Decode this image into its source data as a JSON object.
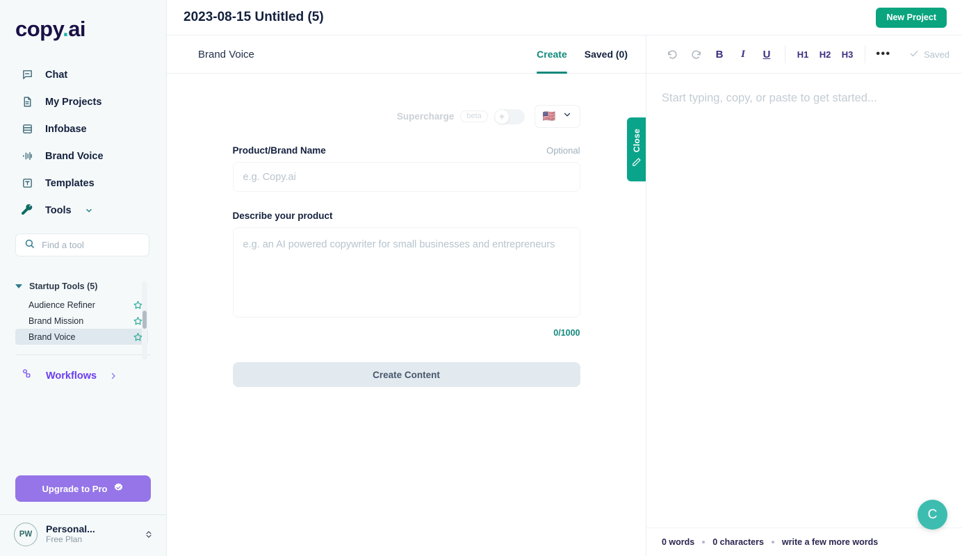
{
  "brand": {
    "logo_main": "copy",
    "logo_dot": ".",
    "logo_suffix": "ai"
  },
  "colors": {
    "accent_teal": "#12897c",
    "brand_green": "#0aa47f",
    "purple": "#6b3df0",
    "upgrade_purple": "#9575e8",
    "sidebar_bg": "#f5f9fa",
    "fab_teal": "#3dbdb0"
  },
  "sidebar": {
    "nav": [
      {
        "label": "Chat",
        "icon": "chat-bubble-icon"
      },
      {
        "label": "My Projects",
        "icon": "document-icon"
      },
      {
        "label": "Infobase",
        "icon": "database-icon"
      },
      {
        "label": "Brand Voice",
        "icon": "waveform-icon"
      },
      {
        "label": "Templates",
        "icon": "template-icon"
      },
      {
        "label": "Tools",
        "icon": "wrench-icon"
      }
    ],
    "search": {
      "placeholder": "Find a tool",
      "value": "",
      "icon": "search-icon"
    },
    "tool_group": {
      "label": "Startup Tools (5)",
      "items": [
        {
          "label": "Audience Refiner",
          "starred": false
        },
        {
          "label": "Brand Mission",
          "starred": false
        },
        {
          "label": "Brand Voice",
          "starred": false,
          "active": true
        }
      ]
    },
    "workflows": {
      "label": "Workflows",
      "icon": "workflow-icon"
    },
    "upgrade": {
      "label": "Upgrade to Pro",
      "icon": "badge-check-icon"
    },
    "user": {
      "initials": "PW",
      "name": "Personal...",
      "plan": "Free Plan"
    }
  },
  "topbar": {
    "doc_title": "2023-08-15 Untitled (5)",
    "new_project_label": "New Project"
  },
  "form_panel": {
    "tool_title": "Brand Voice",
    "tabs": [
      {
        "label": "Create",
        "active": true
      },
      {
        "label": "Saved (0)",
        "active": false
      }
    ],
    "supercharge": {
      "label": "Supercharge",
      "badge": "beta",
      "enabled": false,
      "icon": "lightning-bolt-icon"
    },
    "language": {
      "flag": "🇺🇸",
      "icon": "chevron-down-icon"
    },
    "fields": [
      {
        "label": "Product/Brand Name",
        "optional_label": "Optional",
        "placeholder": "e.g. Copy.ai",
        "value": ""
      },
      {
        "label": "Describe your product",
        "placeholder": "e.g. an AI powered copywriter for small businesses and entrepreneurs",
        "value": "",
        "counter": "0/1000"
      }
    ],
    "submit_label": "Create Content",
    "close_tab": {
      "label": "Close",
      "icon": "pencil-icon"
    }
  },
  "editor": {
    "toolbar": [
      {
        "name": "undo",
        "glyph": "↺",
        "muted": true
      },
      {
        "name": "redo",
        "glyph": "↻",
        "muted": true
      },
      {
        "name": "bold",
        "glyph": "B",
        "muted": false
      },
      {
        "name": "italic",
        "glyph": "I",
        "muted": false
      },
      {
        "name": "underline",
        "glyph": "U",
        "muted": false
      }
    ],
    "headings": [
      "H1",
      "H2",
      "H3"
    ],
    "more_glyph": "•••",
    "saved_label": "Saved",
    "placeholder": "Start typing, copy, or paste to get started...",
    "status": {
      "words": "0 words",
      "characters": "0 characters",
      "hint": "write a few more words"
    },
    "fab_label": "C"
  }
}
